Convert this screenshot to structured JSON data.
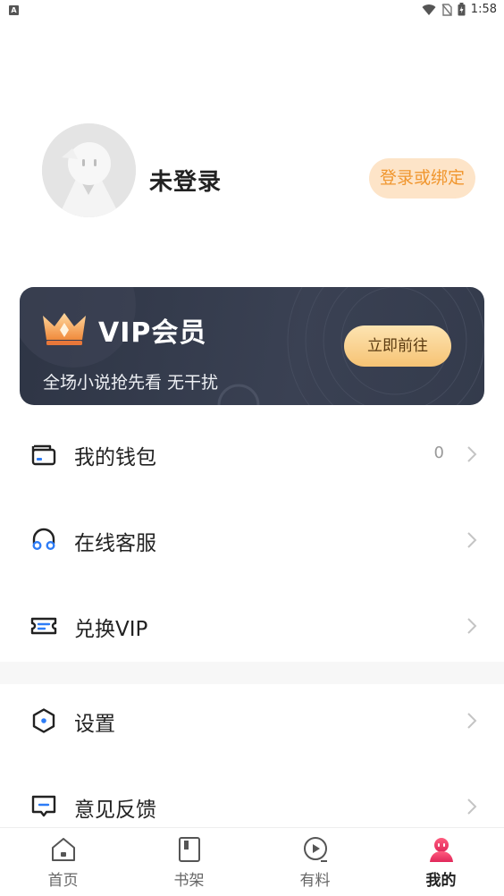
{
  "status_bar": {
    "time": "1:58"
  },
  "profile": {
    "username": "未登录",
    "login_button": "登录或绑定"
  },
  "vip": {
    "title": "VIP会员",
    "subtitle": "全场小说抢先看 无干扰",
    "cta": "立即前往"
  },
  "menu": [
    {
      "label": "我的钱包",
      "value": "0",
      "icon": "wallet-icon"
    },
    {
      "label": "在线客服",
      "value": "",
      "icon": "headset-icon"
    },
    {
      "label": "兑换VIP",
      "value": "",
      "icon": "ticket-icon"
    },
    {
      "label": "设置",
      "value": "",
      "icon": "settings-icon"
    },
    {
      "label": "意见反馈",
      "value": "",
      "icon": "feedback-icon"
    }
  ],
  "bottom_nav": [
    {
      "label": "首页",
      "icon": "home-icon",
      "active": false
    },
    {
      "label": "书架",
      "icon": "bookshelf-icon",
      "active": false
    },
    {
      "label": "有料",
      "icon": "play-icon",
      "active": false
    },
    {
      "label": "我的",
      "icon": "profile-icon",
      "active": true
    }
  ],
  "colors": {
    "accent_orange": "#f0962e",
    "login_button_bg": "#fde4c8",
    "vip_card_bg": "#2e3545",
    "vip_button": "#f6c374",
    "active_nav": "#e8356f",
    "icon_blue": "#2d7cf6"
  }
}
